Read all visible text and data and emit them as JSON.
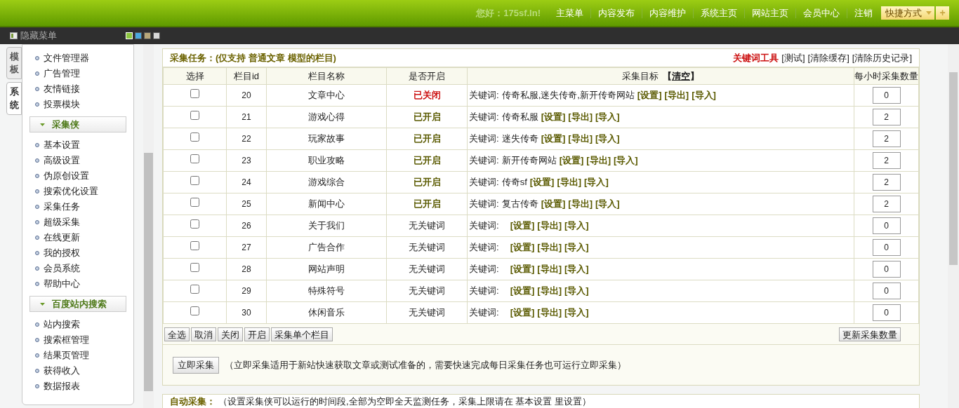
{
  "top_bar": {
    "greeting": "您好：175sf.In!",
    "nav": [
      "主菜单",
      "内容发布",
      "内容维护",
      "系统主页",
      "网站主页",
      "会员中心",
      "注销"
    ],
    "shortcut": {
      "label": "快捷方式",
      "add": "+"
    }
  },
  "menu_bar": {
    "toggle": "隐藏菜单",
    "themes": [
      {
        "color": "#8cc63f",
        "selected": true
      },
      {
        "color": "#4aa8e0",
        "selected": false
      },
      {
        "color": "#b8a77a",
        "selected": false
      },
      {
        "color": "#d8d8d8",
        "selected": false
      }
    ]
  },
  "side_tabs": [
    {
      "label": "模板",
      "selected": false
    },
    {
      "label": "系统",
      "selected": true
    }
  ],
  "sidebar": {
    "sections": [
      {
        "items": [
          "文件管理器",
          "广告管理",
          "友情链接",
          "投票模块"
        ]
      },
      {
        "title": "采集侠",
        "items": [
          "基本设置",
          "高级设置",
          "伪原创设置",
          "搜索优化设置",
          "采集任务",
          "超级采集",
          "在线更新",
          "我的授权",
          "会员系统",
          "帮助中心"
        ]
      },
      {
        "title": "百度站内搜索",
        "items": [
          "站内搜索",
          "搜索框管理",
          "结果页管理",
          "获得收入",
          "数据报表"
        ]
      }
    ]
  },
  "task_panel": {
    "title": "采集任务：(仅支持 普通文章 模型的栏目)",
    "tool_title": "关键词工具",
    "tools": [
      "[测试]",
      "[清除缓存]",
      "[清除历史记录]"
    ],
    "columns": [
      "选择",
      "栏目id",
      "栏目名称",
      "是否开启",
      "采集目标",
      "每小时采集数量"
    ],
    "clear_link": {
      "open": "【",
      "label": "清空",
      "close": "】"
    },
    "rows": [
      {
        "checked": false,
        "id": "20",
        "name": "文章中心",
        "status": "已关闭",
        "kind": "closed",
        "prefix": "关键词:",
        "keywords": "传奇私服,迷失传奇,新开传奇网站",
        "links": [
          "[设置]",
          "[导出]",
          "[导入]"
        ],
        "count": "0"
      },
      {
        "checked": false,
        "id": "21",
        "name": "游戏心得",
        "status": "已开启",
        "kind": "open",
        "prefix": "关键词:",
        "keywords": "传奇私服",
        "links": [
          "[设置]",
          "[导出]",
          "[导入]"
        ],
        "count": "2"
      },
      {
        "checked": false,
        "id": "22",
        "name": "玩家故事",
        "status": "已开启",
        "kind": "open",
        "prefix": "关键词:",
        "keywords": "迷失传奇",
        "links": [
          "[设置]",
          "[导出]",
          "[导入]"
        ],
        "count": "2"
      },
      {
        "checked": false,
        "id": "23",
        "name": "职业攻略",
        "status": "已开启",
        "kind": "open",
        "prefix": "关键词:",
        "keywords": "新开传奇网站",
        "links": [
          "[设置]",
          "[导出]",
          "[导入]"
        ],
        "count": "2"
      },
      {
        "checked": false,
        "id": "24",
        "name": "游戏综合",
        "status": "已开启",
        "kind": "open",
        "prefix": "关键词:",
        "keywords": "传奇sf",
        "links": [
          "[设置]",
          "[导出]",
          "[导入]"
        ],
        "count": "2"
      },
      {
        "checked": false,
        "id": "25",
        "name": "新闻中心",
        "status": "已开启",
        "kind": "open",
        "prefix": "关键词:",
        "keywords": "复古传奇",
        "links": [
          "[设置]",
          "[导出]",
          "[导入]"
        ],
        "count": "2"
      },
      {
        "checked": false,
        "id": "26",
        "name": "关于我们",
        "status": "无关键词",
        "kind": "none",
        "prefix": "关键词:",
        "links": [
          "[设置]",
          "[导出]",
          "[导入]"
        ],
        "count": "0"
      },
      {
        "checked": false,
        "id": "27",
        "name": "广告合作",
        "status": "无关键词",
        "kind": "none",
        "prefix": "关键词:",
        "links": [
          "[设置]",
          "[导出]",
          "[导入]"
        ],
        "count": "0"
      },
      {
        "checked": false,
        "id": "28",
        "name": "网站声明",
        "status": "无关键词",
        "kind": "none",
        "prefix": "关键词:",
        "links": [
          "[设置]",
          "[导出]",
          "[导入]"
        ],
        "count": "0"
      },
      {
        "checked": false,
        "id": "29",
        "name": "特殊符号",
        "status": "无关键词",
        "kind": "none",
        "prefix": "关键词:",
        "links": [
          "[设置]",
          "[导出]",
          "[导入]"
        ],
        "count": "0"
      },
      {
        "checked": false,
        "id": "30",
        "name": "休闲音乐",
        "status": "无关键词",
        "kind": "none",
        "prefix": "关键词:",
        "links": [
          "[设置]",
          "[导出]",
          "[导入]"
        ],
        "count": "0"
      }
    ],
    "footer_buttons": [
      "全选",
      "取消",
      "关闭",
      "开启",
      "采集单个栏目"
    ],
    "update_button": "更新采集数量",
    "run_button": "立即采集",
    "run_note": "（立即采集适用于新站快速获取文章或测试准备的，需要快速完成每日采集任务也可运行立即采集）"
  },
  "auto_panel": {
    "title": "自动采集：",
    "note": "（设置采集侠可以运行的时间段,全部为空即全天监测任务，采集上限请在 基本设置 里设置）"
  }
}
